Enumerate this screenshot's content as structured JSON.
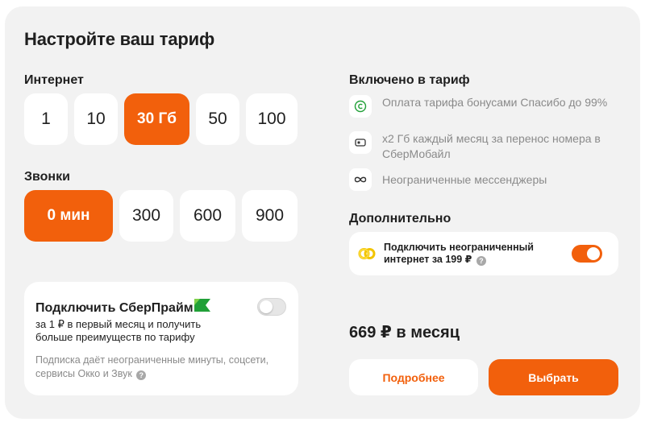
{
  "title": "Настройте ваш тариф",
  "internet": {
    "label": "Интернет",
    "options": [
      "1",
      "10",
      "30 Гб",
      "50",
      "100"
    ],
    "selected_index": 2
  },
  "calls": {
    "label": "Звонки",
    "options": [
      "0 мин",
      "300",
      "600",
      "900"
    ],
    "selected_index": 0
  },
  "sberprime": {
    "title": "Подключить СберПрайм",
    "subtitle": "за 1 ₽ в первый месяц и получить больше преимуществ по тарифу",
    "note": "Подписка даёт неограниченные минуты, соцсети, сервисы Окко и Звук",
    "enabled": false
  },
  "included": {
    "label": "Включено в тариф",
    "items": [
      {
        "icon": "spasibo-icon",
        "text": "Оплата тарифа бонусами Спасибо до 99%"
      },
      {
        "icon": "sim-transfer-icon",
        "text": "x2 Гб каждый месяц за перенос номера в СберМобайл"
      },
      {
        "icon": "infinity-icon",
        "text": "Неограниченные мессенджеры"
      }
    ]
  },
  "extra": {
    "label": "Дополнительно",
    "text": "Подключить неограниченный интернет за 199 ₽",
    "enabled": true
  },
  "price": "669 ₽ в месяц",
  "buttons": {
    "more": "Подробнее",
    "choose": "Выбрать"
  },
  "colors": {
    "accent": "#f2600c",
    "background": "#f2f2f2",
    "muted_text": "#8a8a8a",
    "prime_green": "#21a038"
  }
}
